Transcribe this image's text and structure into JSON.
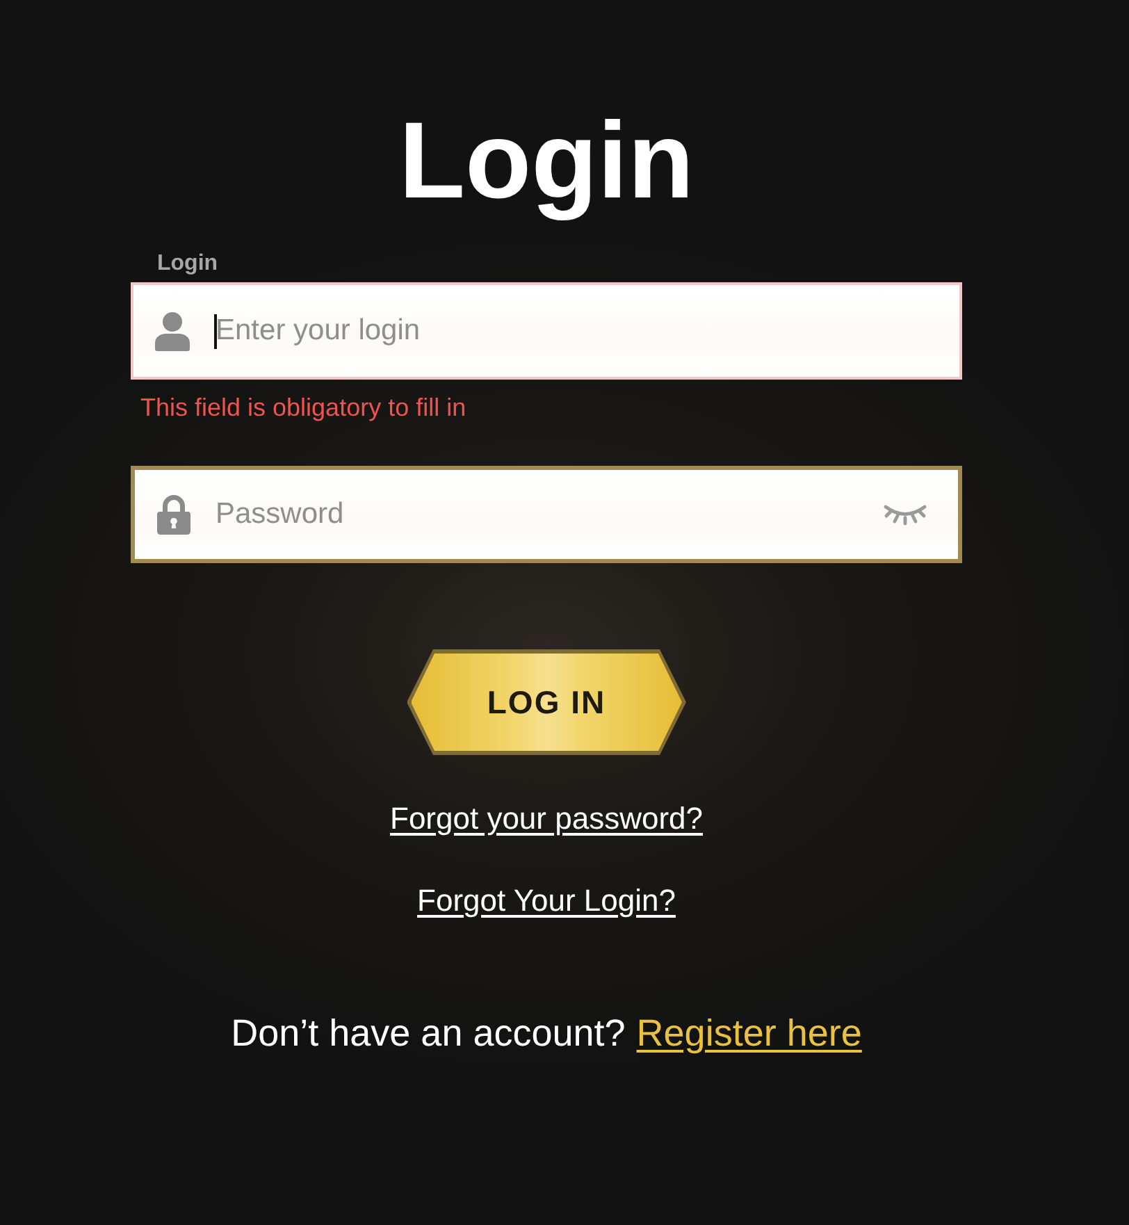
{
  "title": "Login",
  "fields": [
    {
      "kind": "text",
      "label": "Login",
      "placeholder": "Enter your login",
      "focused": true,
      "error": "This field is obligatory to fill in"
    },
    {
      "kind": "password",
      "placeholder": "Password",
      "focused": false
    }
  ],
  "submit": {
    "label": "LOG IN"
  },
  "links": [
    "Forgot your password?",
    "Forgot Your Login?"
  ],
  "register": {
    "prompt": "Don’t have an account?",
    "link": "Register here"
  }
}
